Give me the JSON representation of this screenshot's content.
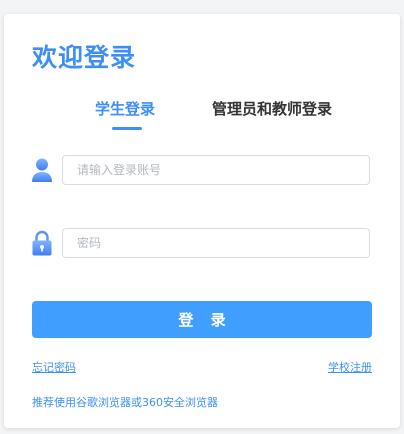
{
  "login": {
    "title": "欢迎登录",
    "tabs": [
      {
        "label": "学生登录",
        "active": true
      },
      {
        "label": "管理员和教师登录",
        "active": false
      }
    ],
    "username": {
      "placeholder": "请输入登录账号",
      "value": "",
      "icon": "user-icon"
    },
    "password": {
      "placeholder": "密码",
      "value": "",
      "icon": "lock-icon"
    },
    "submit_label": "登 录",
    "forgot_label": "忘记密码",
    "register_label": "学校注册",
    "browser_tip": "推荐使用谷歌浏览器或360安全浏览器"
  },
  "colors": {
    "accent": "#409eff",
    "tab_inactive": "#333333",
    "background": "#f3f4f6"
  }
}
